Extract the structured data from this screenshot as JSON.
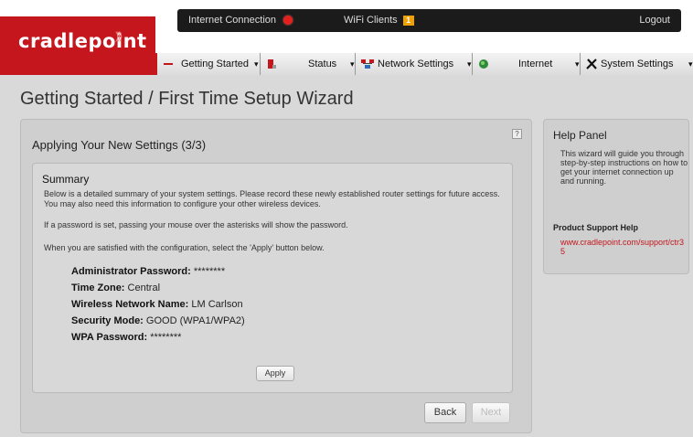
{
  "brand": {
    "logo_text": "cradlepoint",
    "accent": "#c4161c"
  },
  "topbar": {
    "internet_connection": "Internet Connection",
    "wifi_clients": "WiFi Clients",
    "wifi_count": "1",
    "logout": "Logout"
  },
  "nav": {
    "items": [
      {
        "label": "Getting Started",
        "icon": "wand-icon"
      },
      {
        "label": "Status",
        "icon": "status-icon"
      },
      {
        "label": "Network Settings",
        "icon": "network-icon"
      },
      {
        "label": "Internet",
        "icon": "globe-icon"
      },
      {
        "label": "System Settings",
        "icon": "tools-icon"
      }
    ]
  },
  "page": {
    "title": "Getting Started / First Time Setup Wizard"
  },
  "main": {
    "title": "Applying Your New Settings (3/3)",
    "help_q": "?",
    "summary": {
      "title": "Summary",
      "para1": "Below is a detailed summary of your system settings. Please record these newly established router settings for future access. You may also need this information to configure your other wireless devices.",
      "para2": "If a password is set, passing your mouse over the asterisks will show the password.",
      "para3": "When you are satisfied with the configuration, select the 'Apply' button below.",
      "details": [
        {
          "label": "Administrator Password:",
          "value": "********"
        },
        {
          "label": "Time Zone:",
          "value": "Central"
        },
        {
          "label": "Wireless Network Name:",
          "value": "LM Carlson"
        },
        {
          "label": "Security Mode:",
          "value": "GOOD (WPA1/WPA2)"
        },
        {
          "label": "WPA Password:",
          "value": "********"
        }
      ],
      "apply": "Apply"
    },
    "back": "Back",
    "next": "Next"
  },
  "help": {
    "title": "Help Panel",
    "text": "This wizard will guide you through step-by-step instructions on how to get your internet connection up and running.",
    "support_title": "Product Support Help",
    "support_link": "www.cradlepoint.com/support/ctr35"
  }
}
